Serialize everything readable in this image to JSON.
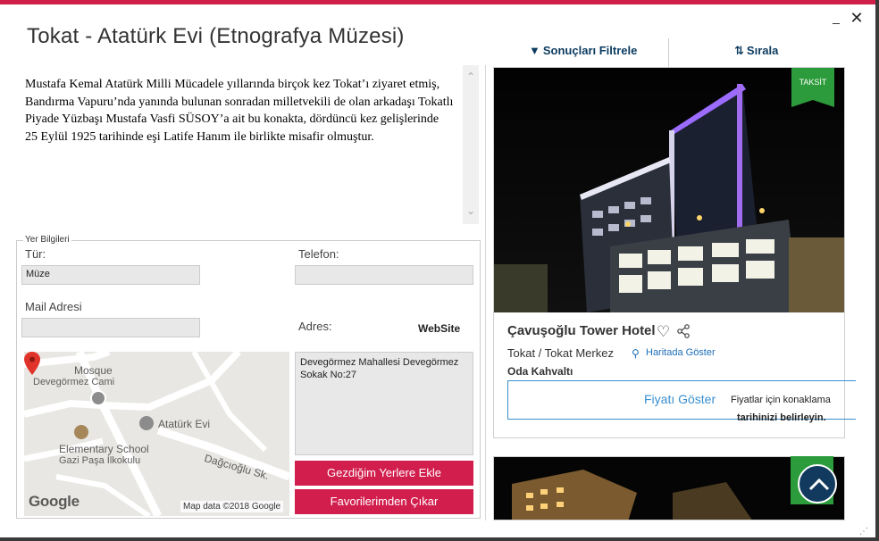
{
  "window": {
    "minimize_glyph": "_",
    "close_glyph": "✕",
    "resize_glyph": "⋰"
  },
  "page_title": "Tokat - Atatürk Evi (Etnografya Müzesi)",
  "description": "Mustafa Kemal Atatürk Milli Mücadele yıllarında birçok kez Tokat’ı ziyaret etmiş, Bandırma Vapuru’nda yanında bulunan sonradan milletvekili de olan arkadaşı Tokatlı Piyade Yüzbaşı Mustafa Vasfi SÜSOY’a ait bu konakta, dördüncü kez gelişlerinde 25 Eylül 1925 tarihinde eşi Latife Hanım ile birlikte misafir olmuştur.",
  "scroll": {
    "up_glyph": "⌃",
    "down_glyph": "⌄"
  },
  "info": {
    "legend": "Yer Bilgileri",
    "type_label": "Tür:",
    "type_value": "Müze",
    "phone_label": "Telefon:",
    "phone_value": "",
    "mail_label": "Mail Adresi",
    "mail_value": "",
    "address_label": "Adres:",
    "website_label": "WebSite",
    "address_value": "Devegörmez Mahallesi Devegörmez Sokak No:27"
  },
  "map": {
    "poi_mosque": "Mosque",
    "poi_mosque_sub": "Devegörmez Cami",
    "poi_museum": "Atatürk Evi",
    "poi_school": "Elementary School",
    "poi_school_sub": "Gazi Paşa İlkokulu",
    "street": "Dağcıoğlu Sk.",
    "logo": "Google",
    "attribution": "Map data ©2018 Google"
  },
  "buttons": {
    "add_visited": "Gezdiğim Yerlere Ekle",
    "remove_favorite": "Favorilerimden Çıkar"
  },
  "tabs": {
    "filter": "Sonuçları Filtrele",
    "sort": "Sırala"
  },
  "hotel": {
    "name": "Çavuşoğlu Tower Hotel",
    "location": "Tokat / Tokat Merkez",
    "map_link": "Haritada Göster",
    "board": "Oda Kahvaltı",
    "price_button": "Fiyatı Göster",
    "price_note_line1": "Fiyatlar için konaklama",
    "price_note_line2": "tarihinizi belirleyin.",
    "badge": "TAKSİT"
  },
  "colors": {
    "accent": "#d21e4d",
    "link": "#1d6fb8",
    "navy": "#123a5e",
    "badge_green": "#2c9b3b"
  }
}
